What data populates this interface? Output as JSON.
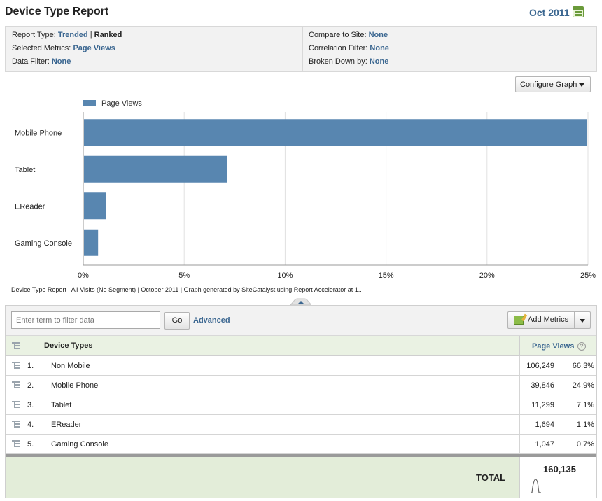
{
  "header": {
    "title": "Device Type Report",
    "date": "Oct 2011"
  },
  "params": {
    "report_type_label": "Report Type:",
    "report_type_trended": "Trended",
    "report_type_sep": "|",
    "report_type_ranked": "Ranked",
    "metrics_label": "Selected Metrics:",
    "metrics_value": "Page Views",
    "data_filter_label": "Data Filter:",
    "data_filter_value": "None",
    "compare_label": "Compare to Site:",
    "compare_value": "None",
    "correlation_label": "Correlation Filter:",
    "correlation_value": "None",
    "broken_label": "Broken Down by:",
    "broken_value": "None"
  },
  "configure_graph_label": "Configure Graph",
  "chart_data": {
    "type": "bar",
    "orientation": "horizontal",
    "categories": [
      "Mobile Phone",
      "Tablet",
      "EReader",
      "Gaming Console"
    ],
    "series": [
      {
        "name": "Page Views",
        "values": [
          24.9,
          7.1,
          1.1,
          0.7
        ]
      }
    ],
    "xlim": [
      0,
      25
    ],
    "xticks": [
      "0%",
      "5%",
      "10%",
      "15%",
      "20%",
      "25%"
    ],
    "grid": true,
    "legend_position": "top-left",
    "bar_color": "#5886b0"
  },
  "footnote": "Device Type Report | All Visits (No Segment) | October 2011 | Graph generated by SiteCatalyst using Report Accelerator at  1..",
  "toolbar": {
    "filter_placeholder": "Enter term to filter data",
    "go_label": "Go",
    "advanced_label": "Advanced",
    "add_metrics_label": "Add Metrics"
  },
  "table": {
    "col_device": "Device Types",
    "col_metric": "Page Views",
    "help_glyph": "?",
    "rows": [
      {
        "rank": "1.",
        "name": "Non Mobile",
        "value": "106,249",
        "pct": "66.3%"
      },
      {
        "rank": "2.",
        "name": "Mobile Phone",
        "value": "39,846",
        "pct": "24.9%"
      },
      {
        "rank": "3.",
        "name": "Tablet",
        "value": "11,299",
        "pct": "7.1%"
      },
      {
        "rank": "4.",
        "name": "EReader",
        "value": "1,694",
        "pct": "1.1%"
      },
      {
        "rank": "5.",
        "name": "Gaming Console",
        "value": "1,047",
        "pct": "0.7%"
      }
    ],
    "total_label": "TOTAL",
    "total_value": "160,135"
  },
  "colors": {
    "accent_link": "#3a6690",
    "bar": "#5886b0",
    "header_green": "#eaf2e3"
  }
}
